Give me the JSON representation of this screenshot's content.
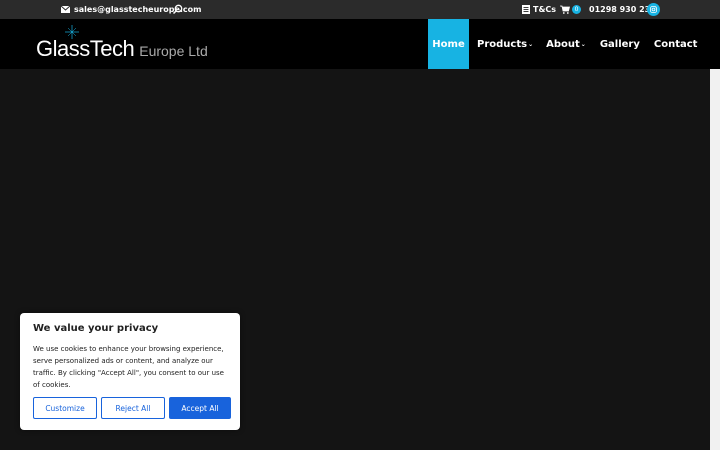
{
  "topbar": {
    "email": "sales@glasstecheurope.com",
    "tcs_label": "T&Cs",
    "cart_count": "0",
    "phone": "01298 930 238"
  },
  "logo": {
    "part1": "Glass",
    "part2": "Tech",
    "part3": "Europe Ltd"
  },
  "nav": {
    "items": [
      {
        "label": "Home",
        "active": true
      },
      {
        "label": "Products",
        "dropdown": true
      },
      {
        "label": "About",
        "dropdown": true
      },
      {
        "label": "Gallery"
      },
      {
        "label": "Contact"
      }
    ]
  },
  "cookie": {
    "title": "We value your privacy",
    "body": "We use cookies to enhance your browsing experience, serve personalized ads or content, and analyze our traffic. By clicking \"Accept All\", you consent to our use of cookies.",
    "customize": "Customize",
    "reject": "Reject All",
    "accept": "Accept All"
  },
  "colors": {
    "accent": "#17b3e3",
    "button_blue": "#1863dc",
    "topbar_bg": "#2b2b2b",
    "header_bg": "#000000",
    "hero_bg": "#141414"
  }
}
